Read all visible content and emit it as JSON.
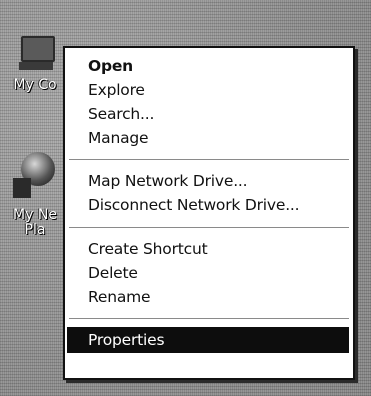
{
  "desktop": {
    "icons": [
      {
        "label": "My Co",
        "icon": "my-computer-icon"
      },
      {
        "label_line1": "My Ne",
        "label_line2": "Pla",
        "icon": "my-network-places-icon"
      }
    ]
  },
  "context_menu": {
    "groups": [
      {
        "items": [
          {
            "label": "Open",
            "bold": true
          },
          {
            "label": "Explore"
          },
          {
            "label": "Search..."
          },
          {
            "label": "Manage"
          }
        ]
      },
      {
        "items": [
          {
            "label": "Map Network Drive..."
          },
          {
            "label": "Disconnect Network Drive..."
          }
        ]
      },
      {
        "items": [
          {
            "label": "Create Shortcut"
          },
          {
            "label": "Delete"
          },
          {
            "label": "Rename"
          }
        ]
      },
      {
        "items": [
          {
            "label": "Properties",
            "selected": true
          }
        ]
      }
    ]
  },
  "colors": {
    "menu_background": "#ffffff",
    "selection_background": "#0d0d0d",
    "selection_text": "#ffffff",
    "menu_text": "#111111"
  }
}
